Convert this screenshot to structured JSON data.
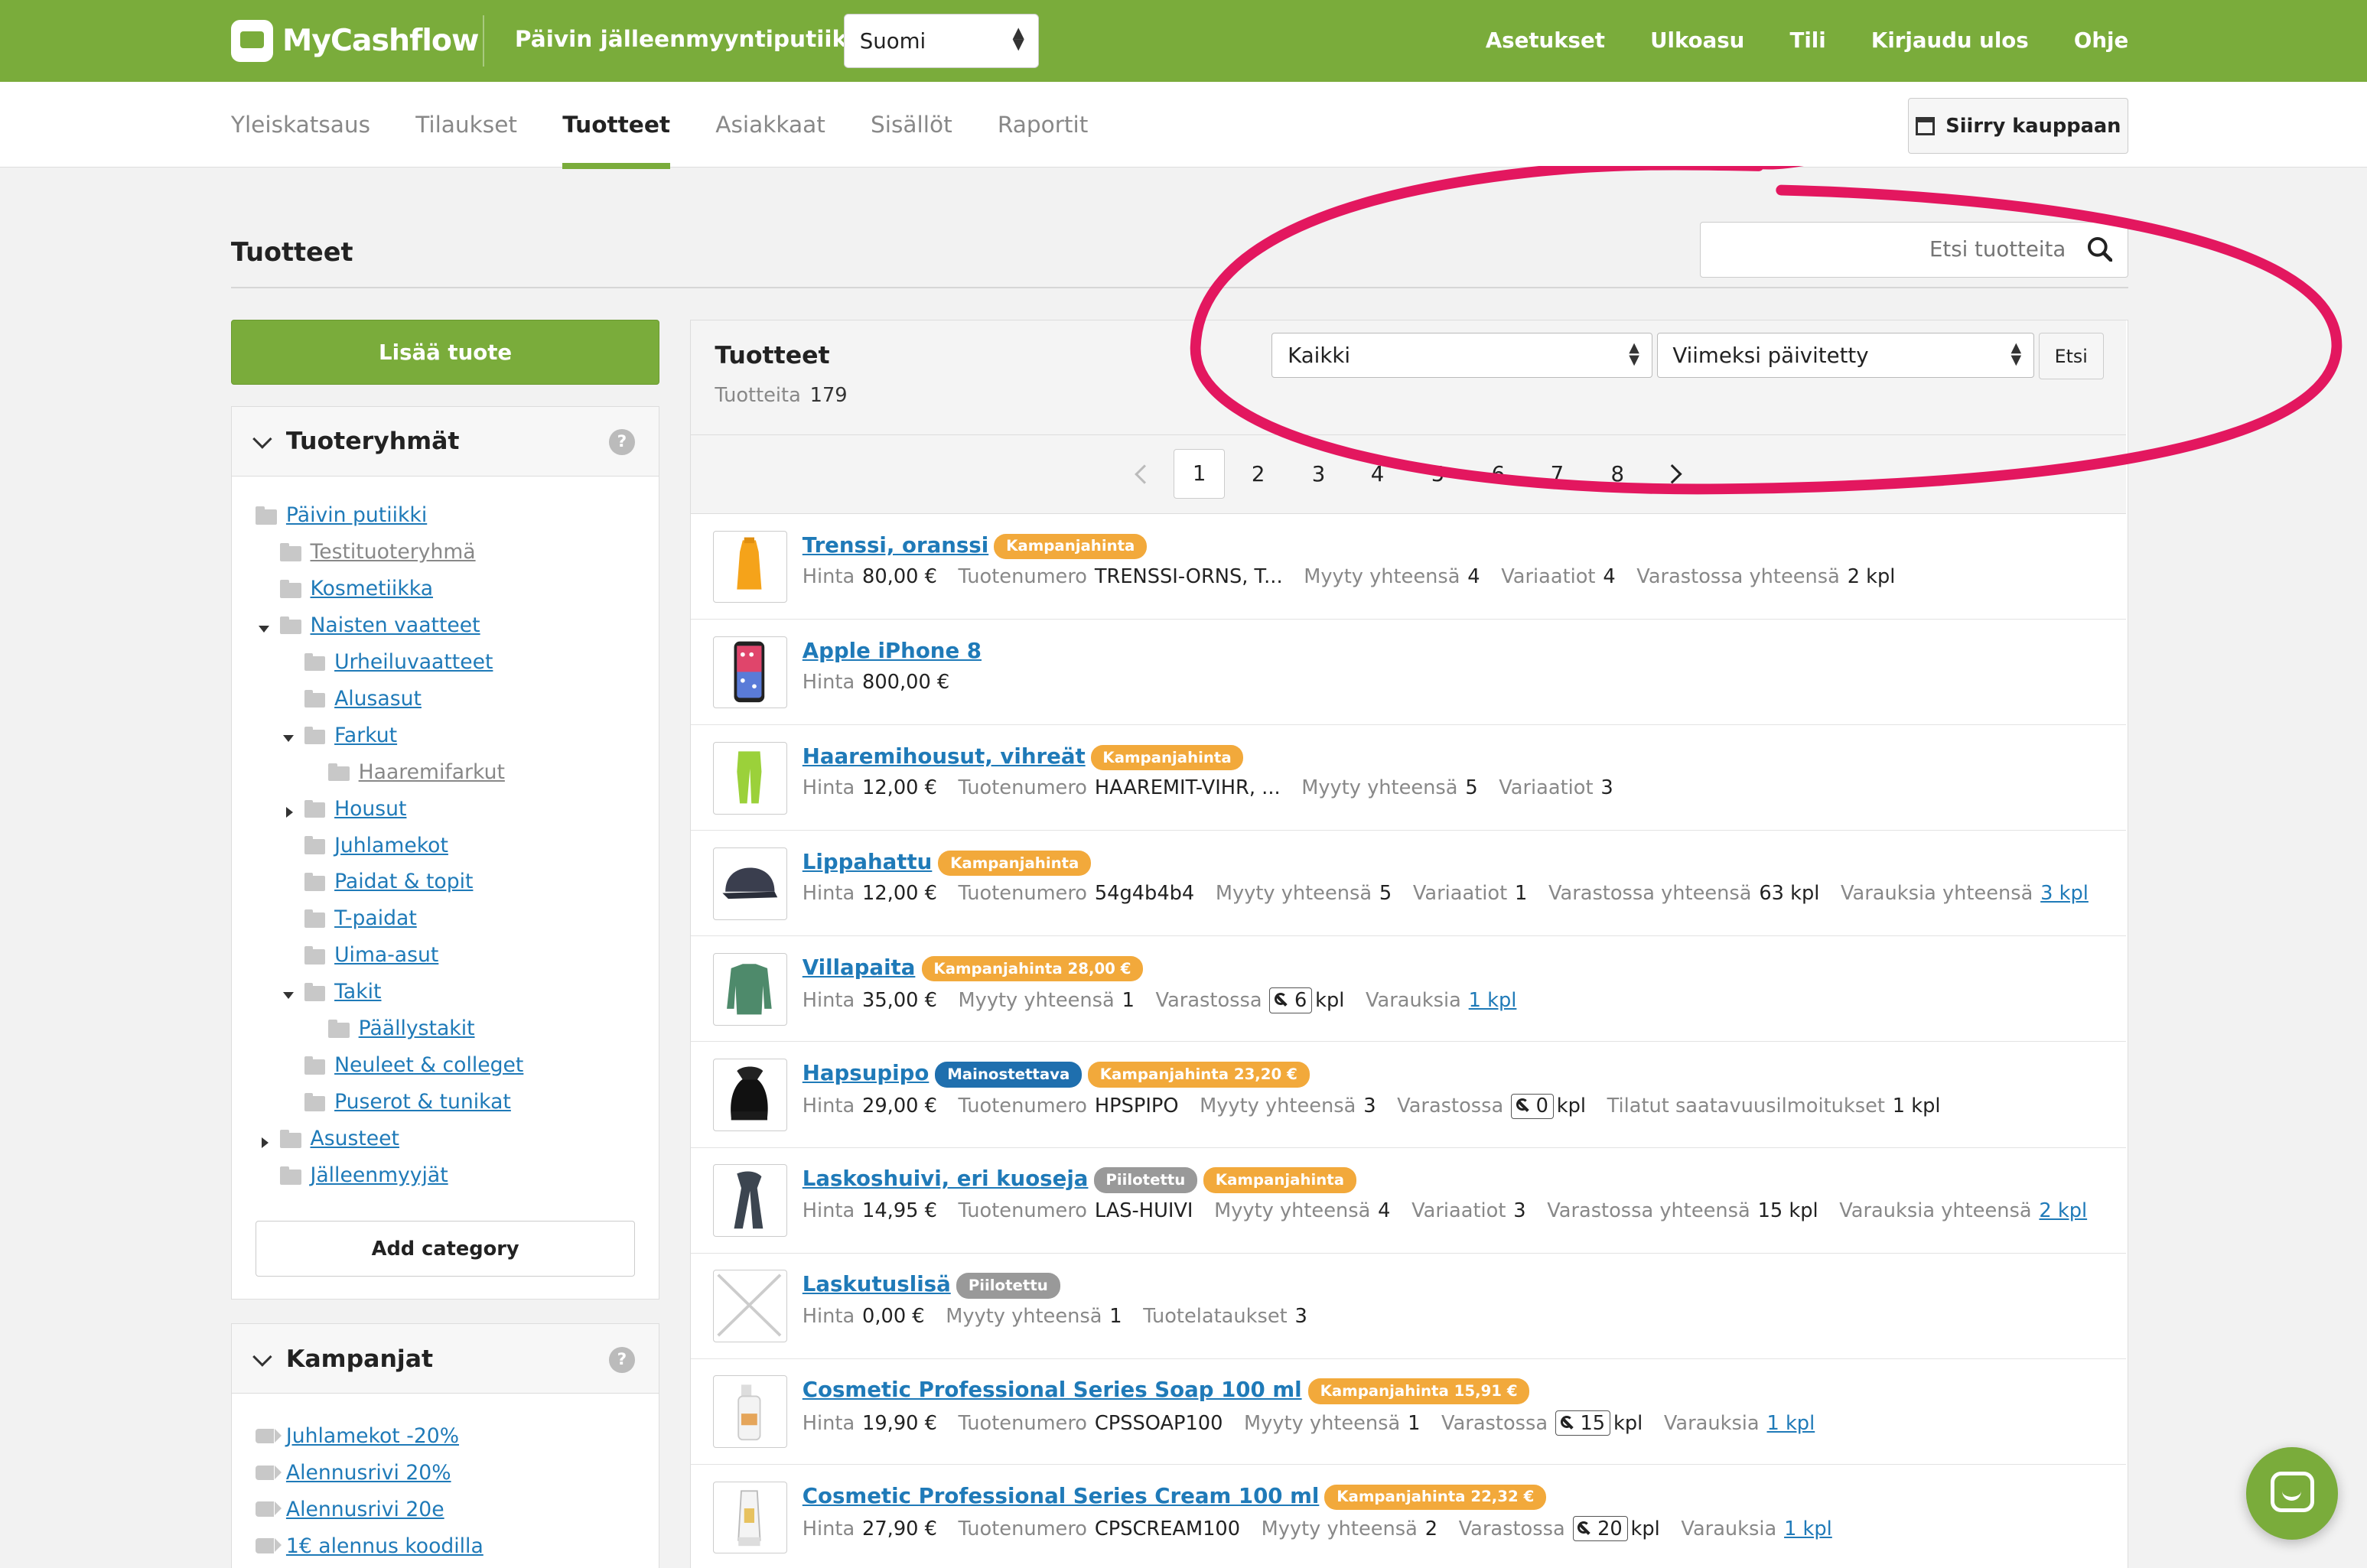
{
  "app": {
    "logo_text": "MyCashflow",
    "shop_name": "Päivin jälleenmyyntiputiikki",
    "language": "Suomi",
    "top_links": [
      "Asetukset",
      "Ulkoasu",
      "Tili",
      "Kirjaudu ulos",
      "Ohje"
    ]
  },
  "nav": {
    "tabs": [
      "Yleiskatsaus",
      "Tilaukset",
      "Tuotteet",
      "Asiakkaat",
      "Sisällöt",
      "Raportit"
    ],
    "active_tab": "Tuotteet",
    "goto_shop": "Siirry kauppaan"
  },
  "page": {
    "title": "Tuotteet",
    "search_placeholder": "Etsi tuotteita"
  },
  "sidebar": {
    "add_product": "Lisää tuote",
    "categories_title": "Tuoteryhmät",
    "help": "?",
    "categories": [
      {
        "label": "Päivin putiikki",
        "level": 0,
        "toggle": "none",
        "muted": false
      },
      {
        "label": "Testituoteryhmä",
        "level": 1,
        "toggle": "none",
        "muted": true
      },
      {
        "label": "Kosmetiikka",
        "level": 1,
        "toggle": "none",
        "muted": false
      },
      {
        "label": "Naisten vaatteet",
        "level": 1,
        "toggle": "down",
        "muted": false
      },
      {
        "label": "Urheiluvaatteet",
        "level": 2,
        "toggle": "none",
        "muted": false
      },
      {
        "label": "Alusasut",
        "level": 2,
        "toggle": "none",
        "muted": false
      },
      {
        "label": "Farkut",
        "level": 2,
        "toggle": "down",
        "muted": false
      },
      {
        "label": "Haaremifarkut",
        "level": 3,
        "toggle": "none",
        "muted": true
      },
      {
        "label": "Housut",
        "level": 2,
        "toggle": "right",
        "muted": false
      },
      {
        "label": "Juhlamekot",
        "level": 2,
        "toggle": "none",
        "muted": false
      },
      {
        "label": "Paidat & topit",
        "level": 2,
        "toggle": "none",
        "muted": false
      },
      {
        "label": "T-paidat",
        "level": 2,
        "toggle": "none",
        "muted": false
      },
      {
        "label": "Uima-asut",
        "level": 2,
        "toggle": "none",
        "muted": false
      },
      {
        "label": "Takit",
        "level": 2,
        "toggle": "down",
        "muted": false
      },
      {
        "label": "Päällystakit",
        "level": 3,
        "toggle": "none",
        "muted": false
      },
      {
        "label": "Neuleet & colleget",
        "level": 2,
        "toggle": "none",
        "muted": false
      },
      {
        "label": "Puserot & tunikat",
        "level": 2,
        "toggle": "none",
        "muted": false
      },
      {
        "label": "Asusteet",
        "level": 1,
        "toggle": "right",
        "muted": false
      },
      {
        "label": "Jälleenmyyjät",
        "level": 1,
        "toggle": "none",
        "muted": false
      }
    ],
    "add_category": "Add category",
    "campaigns_title": "Kampanjat",
    "campaigns": [
      "Juhlamekot -20%",
      "Alennusrivi 20%",
      "Alennusrivi 20e",
      "1€ alennus koodilla"
    ]
  },
  "products": {
    "title": "Tuotteet",
    "count_label": "Tuotteita",
    "count": "179",
    "filter": "Kaikki",
    "sort": "Viimeksi päivitetty",
    "search_button": "Etsi",
    "pages": [
      "1",
      "2",
      "3",
      "4",
      "5",
      "6",
      "7",
      "8"
    ],
    "current_page": "1",
    "items": [
      {
        "name": "Trenssi, oranssi",
        "image": "orange-dress",
        "badges": [
          {
            "text": "Kampanjahinta",
            "color": "orange"
          }
        ],
        "meta": [
          {
            "k": "Hinta",
            "v": "80,00 €"
          },
          {
            "k": "Tuotenumero",
            "v": "TRENSSI-ORNS, T..."
          },
          {
            "k": "Myyty yhteensä",
            "v": "4"
          },
          {
            "k": "Variaatiot",
            "v": "4"
          },
          {
            "k": "Varastossa yhteensä",
            "v": "2 kpl"
          }
        ]
      },
      {
        "name": "Apple iPhone 8",
        "image": "phone",
        "badges": [],
        "meta": [
          {
            "k": "Hinta",
            "v": "800,00 €"
          }
        ]
      },
      {
        "name": "Haaremihousut, vihreät",
        "image": "green-pants",
        "badges": [
          {
            "text": "Kampanjahinta",
            "color": "orange"
          }
        ],
        "meta": [
          {
            "k": "Hinta",
            "v": "12,00 €"
          },
          {
            "k": "Tuotenumero",
            "v": "HAAREMIT-VIHR, ..."
          },
          {
            "k": "Myyty yhteensä",
            "v": "5"
          },
          {
            "k": "Variaatiot",
            "v": "3"
          }
        ]
      },
      {
        "name": "Lippahattu",
        "image": "cap",
        "badges": [
          {
            "text": "Kampanjahinta",
            "color": "orange"
          }
        ],
        "meta": [
          {
            "k": "Hinta",
            "v": "12,00 €"
          },
          {
            "k": "Tuotenumero",
            "v": "54g4b4b4"
          },
          {
            "k": "Myyty yhteensä",
            "v": "5"
          },
          {
            "k": "Variaatiot",
            "v": "1"
          },
          {
            "k": "Varastossa yhteensä",
            "v": "63 kpl"
          },
          {
            "k": "Varauksia yhteensä",
            "link": "3 kpl"
          }
        ]
      },
      {
        "name": "Villapaita",
        "image": "sweater",
        "badges": [
          {
            "text": "Kampanjahinta 28,00 €",
            "color": "orange"
          }
        ],
        "meta": [
          {
            "k": "Hinta",
            "v": "35,00 €"
          },
          {
            "k": "Myyty yhteensä",
            "v": "1"
          },
          {
            "k": "Varastossa",
            "stock": "6",
            "unit": "kpl"
          },
          {
            "k": "Varauksia",
            "link": "1 kpl"
          }
        ]
      },
      {
        "name": "Hapsupipo",
        "image": "beanie",
        "badges": [
          {
            "text": "Mainostettava",
            "color": "blue"
          },
          {
            "text": "Kampanjahinta 23,20 €",
            "color": "orange"
          }
        ],
        "meta": [
          {
            "k": "Hinta",
            "v": "29,00 €"
          },
          {
            "k": "Tuotenumero",
            "v": "HPSPIPO"
          },
          {
            "k": "Myyty yhteensä",
            "v": "3"
          },
          {
            "k": "Varastossa",
            "stock": "0",
            "unit": "kpl"
          },
          {
            "k": "Tilatut saatavuusilmoitukset",
            "v": "1 kpl"
          }
        ]
      },
      {
        "name": "Laskoshuivi, eri kuoseja",
        "image": "scarf",
        "badges": [
          {
            "text": "Piilotettu",
            "color": "gray"
          },
          {
            "text": "Kampanjahinta",
            "color": "orange"
          }
        ],
        "meta": [
          {
            "k": "Hinta",
            "v": "14,95 €"
          },
          {
            "k": "Tuotenumero",
            "v": "LAS-HUIVI"
          },
          {
            "k": "Myyty yhteensä",
            "v": "4"
          },
          {
            "k": "Variaatiot",
            "v": "3"
          },
          {
            "k": "Varastossa yhteensä",
            "v": "15 kpl"
          },
          {
            "k": "Varauksia yhteensä",
            "link": "2 kpl"
          }
        ]
      },
      {
        "name": "Laskutuslisä",
        "image": "none",
        "badges": [
          {
            "text": "Piilotettu",
            "color": "gray"
          }
        ],
        "meta": [
          {
            "k": "Hinta",
            "v": "0,00 €"
          },
          {
            "k": "Myyty yhteensä",
            "v": "1"
          },
          {
            "k": "Tuotelataukset",
            "v": "3"
          }
        ]
      },
      {
        "name": "Cosmetic Professional Series Soap 100 ml",
        "image": "soap",
        "badges": [
          {
            "text": "Kampanjahinta 15,91 €",
            "color": "orange"
          }
        ],
        "meta": [
          {
            "k": "Hinta",
            "v": "19,90 €"
          },
          {
            "k": "Tuotenumero",
            "v": "CPSSOAP100"
          },
          {
            "k": "Myyty yhteensä",
            "v": "1"
          },
          {
            "k": "Varastossa",
            "stock": "15",
            "unit": "kpl"
          },
          {
            "k": "Varauksia",
            "link": "1 kpl"
          }
        ]
      },
      {
        "name": "Cosmetic Professional Series Cream 100 ml",
        "image": "cream",
        "badges": [
          {
            "text": "Kampanjahinta 22,32 €",
            "color": "orange"
          }
        ],
        "meta": [
          {
            "k": "Hinta",
            "v": "27,90 €"
          },
          {
            "k": "Tuotenumero",
            "v": "CPSCREAM100"
          },
          {
            "k": "Myyty yhteensä",
            "v": "2"
          },
          {
            "k": "Varastossa",
            "stock": "20",
            "unit": "kpl"
          },
          {
            "k": "Varauksia",
            "link": "1 kpl"
          }
        ]
      }
    ]
  },
  "colors": {
    "brand_green": "#7aac3b",
    "link_blue": "#1f7ab8",
    "badge_orange": "#f2a93b",
    "badge_blue": "#1f6fae",
    "badge_gray": "#999999",
    "annotation_pink": "#e3175f"
  }
}
